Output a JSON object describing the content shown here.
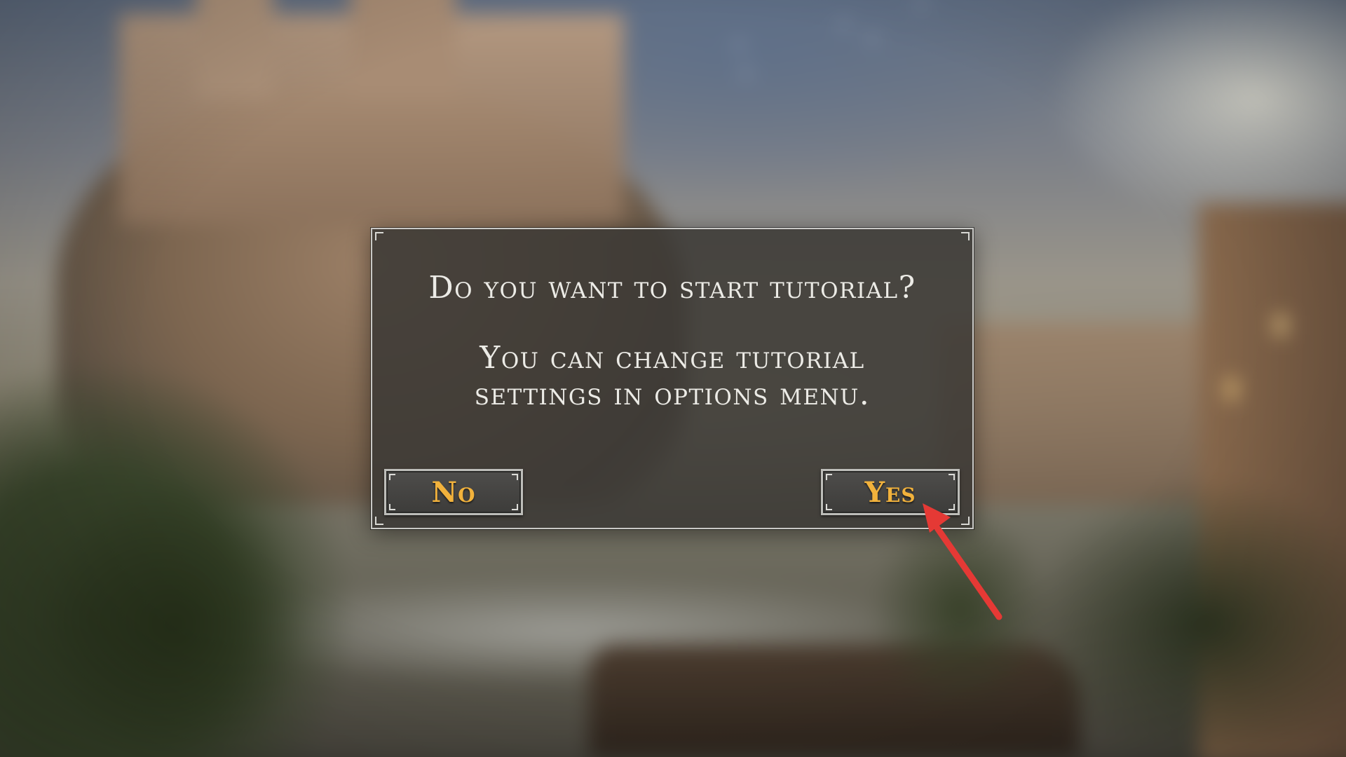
{
  "dialog": {
    "question": "Do you want to start tutorial?",
    "info": "You can change tutorial settings in options menu.",
    "no_label": "No",
    "yes_label": "Yes"
  },
  "colors": {
    "button_text": "#f2b23c",
    "dialog_text": "#ecebe6",
    "arrow": "#e53935"
  },
  "annotation": {
    "type": "arrow",
    "points_to": "yes-button"
  }
}
